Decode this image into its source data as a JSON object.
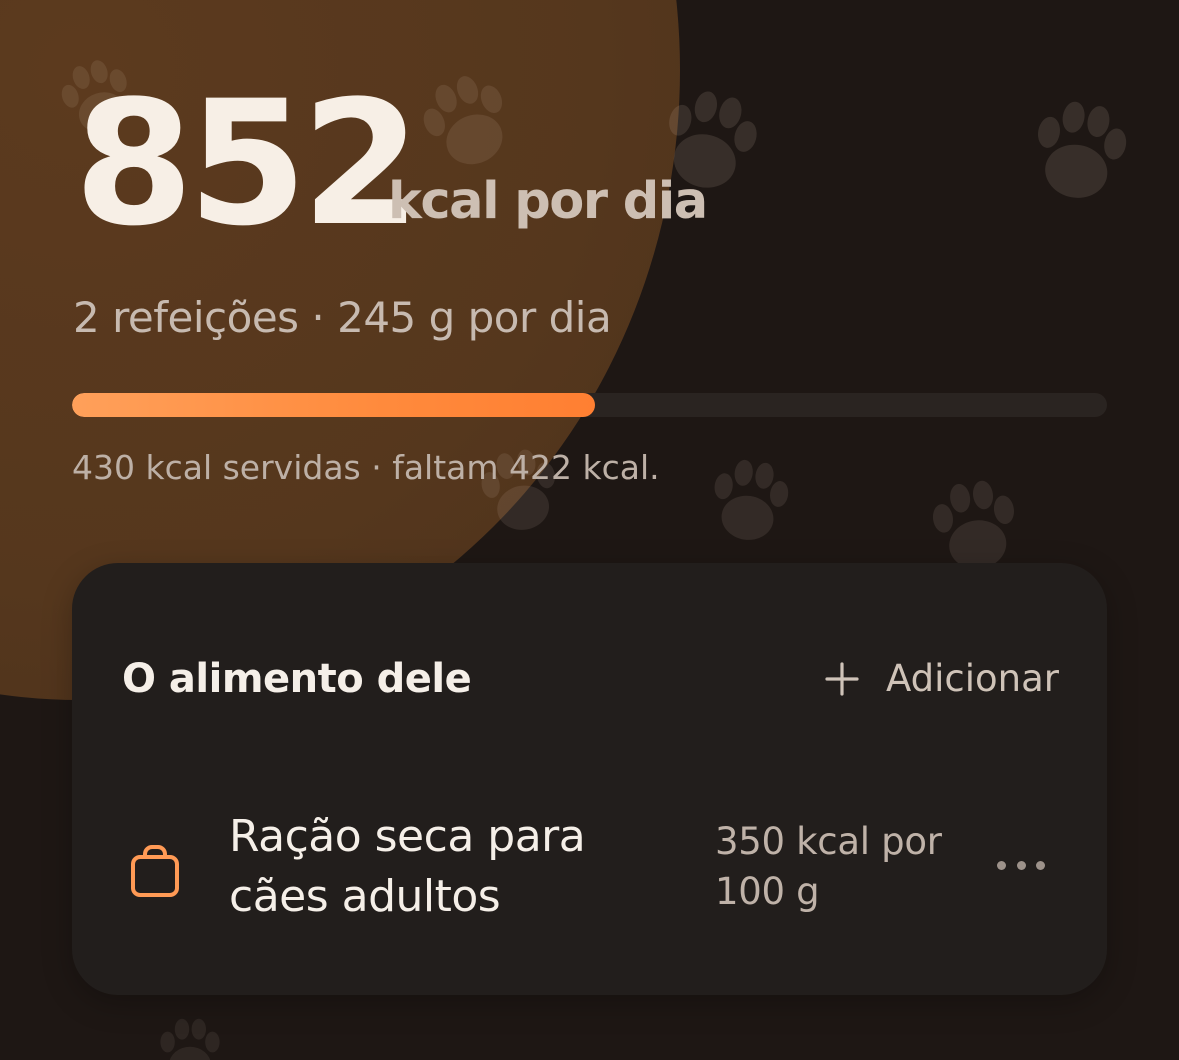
{
  "calories": {
    "value": "852",
    "unit": "kcal por dia"
  },
  "summary": {
    "text": "2 refeições · 245 g por dia"
  },
  "progress": {
    "served_kcal": 430,
    "target_kcal": 852,
    "fraction": 0.505,
    "caption": "430 kcal servidas · faltam 422 kcal."
  },
  "food_card": {
    "title": "O alimento dele",
    "add_label": "Adicionar",
    "items": [
      {
        "name": "Ração seca para cães adultos",
        "kcal": "350 kcal por 100 g",
        "icon": "shopping-bag-icon"
      }
    ]
  },
  "colors": {
    "accent": "#ff8a3c",
    "background": "#1e1714",
    "hero_circle": "#55371d",
    "card": "#221e1c"
  }
}
